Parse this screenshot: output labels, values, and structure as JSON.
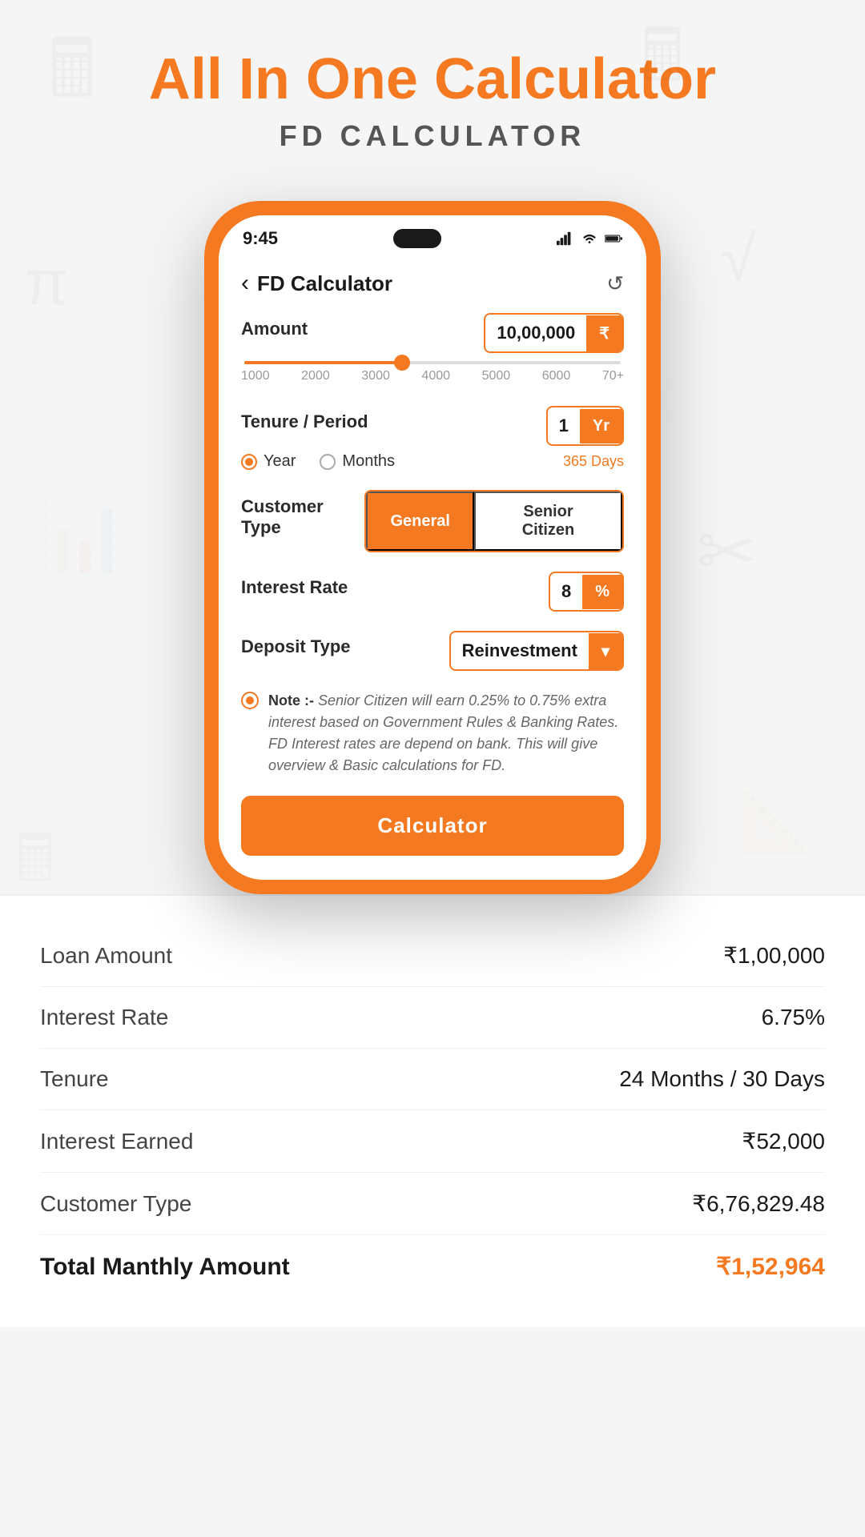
{
  "header": {
    "title_plain": "All In One",
    "title_accent": "Calculator",
    "subtitle": "FD CALCULATOR"
  },
  "status_bar": {
    "time": "9:45",
    "signal": "▂▄▆█",
    "wifi": "wifi",
    "battery": "battery"
  },
  "nav": {
    "back_label": "FD Calculator",
    "refresh_icon": "↺"
  },
  "form": {
    "amount_label": "Amount",
    "amount_value": "10,00,000",
    "amount_unit": "₹",
    "slider_labels": [
      "1000",
      "2000",
      "3000",
      "4000",
      "5000",
      "6000",
      "70+"
    ],
    "tenure_label": "Tenure / Period",
    "tenure_value": "1",
    "tenure_unit": "Yr",
    "tenure_days_hint": "365 Days",
    "year_radio": "Year",
    "months_radio": "Months",
    "year_selected": true,
    "customer_type_label": "Customer Type",
    "general_btn": "General",
    "senior_citizen_btn": "Senior Citizen",
    "general_active": true,
    "interest_rate_label": "Interest Rate",
    "interest_rate_value": "8",
    "interest_rate_unit": "%",
    "deposit_type_label": "Deposit Type",
    "deposit_type_value": "Reinvestment",
    "note_prefix": "Note :-",
    "note_text": "Senior Citizen will earn 0.25% to 0.75% extra interest based on Government Rules & Banking Rates. FD Interest rates are depend on bank. This will give overview & Basic calculations for FD.",
    "calc_button": "Calculator"
  },
  "results": [
    {
      "label": "Loan Amount",
      "value": "₹1,00,000"
    },
    {
      "label": "Interest Rate",
      "value": "6.75%"
    },
    {
      "label": "Tenure",
      "value": "24 Months / 30 Days"
    },
    {
      "label": "Interest Earned",
      "value": "₹52,000"
    },
    {
      "label": "Customer Type",
      "value": "₹6,76,829.48"
    },
    {
      "label": "Total Manthly Amount",
      "value": "₹1,52,964",
      "is_total": true
    }
  ],
  "colors": {
    "orange": "#f47920",
    "dark": "#1a1a1a",
    "gray": "#666666"
  }
}
